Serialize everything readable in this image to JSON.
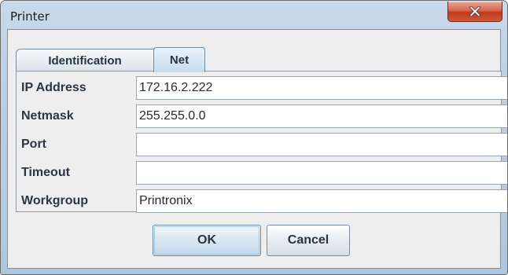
{
  "window": {
    "title": "Printer"
  },
  "close_button": {
    "icon": "close-icon"
  },
  "tabs": [
    {
      "label": "Identification",
      "selected": false
    },
    {
      "label": "Net",
      "selected": true
    }
  ],
  "form": {
    "rows": [
      {
        "label": "IP Address",
        "value": "172.16.2.222"
      },
      {
        "label": "Netmask",
        "value": "255.255.0.0"
      },
      {
        "label": "Port",
        "value": ""
      },
      {
        "label": "Timeout",
        "value": ""
      },
      {
        "label": "Workgroup",
        "value": "Printronix"
      }
    ]
  },
  "buttons": {
    "ok": "OK",
    "cancel": "Cancel"
  },
  "colors": {
    "title_bar": "#bcd0e4",
    "close_button": "#c2381d",
    "dialog_background": "#eeeeee"
  }
}
